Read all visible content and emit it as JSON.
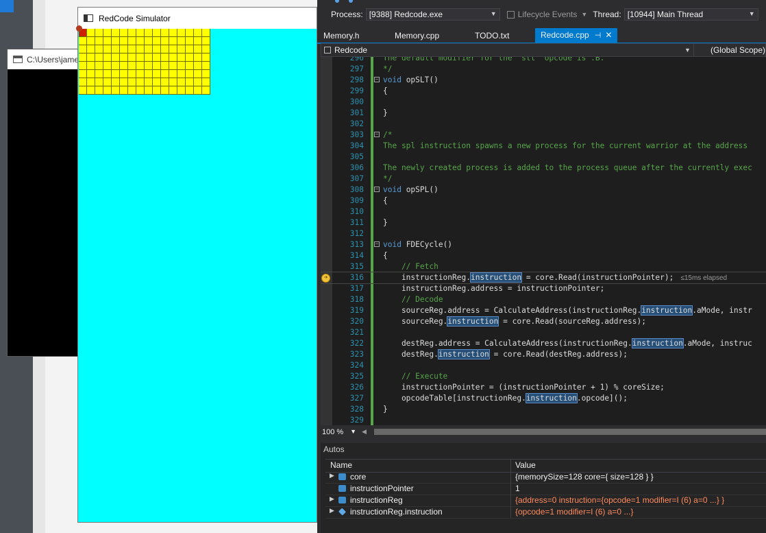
{
  "console": {
    "title": "C:\\Users\\jame"
  },
  "simulator": {
    "title": "RedCode Simulator",
    "memory": {
      "cells": 128,
      "columns": 16,
      "highlighted_cells": [
        0
      ]
    },
    "colors": {
      "background": "#00ffff",
      "cell": "#ffff00",
      "active_cell": "#cc2200"
    }
  },
  "debugbar": {
    "process_label": "Process:",
    "process_value": "[9388] Redcode.exe",
    "lifecycle_label": "Lifecycle Events",
    "thread_label": "Thread:",
    "thread_value": "[10944] Main Thread"
  },
  "tabs": [
    {
      "label": "Memory.h"
    },
    {
      "label": "Memory.cpp"
    },
    {
      "label": "TODO.txt"
    },
    {
      "label": "Redcode.cpp",
      "active": true
    }
  ],
  "navbar": {
    "project": "Redcode",
    "scope": "(Global Scope)"
  },
  "editor": {
    "lines": [
      {
        "n": "296",
        "text": "The default modifier for the 'slt' opcode is .B.",
        "type": "comment"
      },
      {
        "n": "297",
        "text": "*/",
        "type": "comment"
      },
      {
        "n": "298",
        "text": "void opSLT()",
        "type": "func",
        "fold": true
      },
      {
        "n": "299",
        "text": "{",
        "type": "plain"
      },
      {
        "n": "300",
        "text": "",
        "type": "plain"
      },
      {
        "n": "301",
        "text": "}",
        "type": "plain"
      },
      {
        "n": "302",
        "text": "",
        "type": "plain"
      },
      {
        "n": "303",
        "text": "/*",
        "type": "comment",
        "fold": true
      },
      {
        "n": "304",
        "text": "The spl instruction spawns a new process for the current warrior at the address",
        "type": "comment"
      },
      {
        "n": "305",
        "text": "",
        "type": "plain"
      },
      {
        "n": "306",
        "text": "The newly created process is added to the process queue after the currently exec",
        "type": "comment"
      },
      {
        "n": "307",
        "text": "*/",
        "type": "comment"
      },
      {
        "n": "308",
        "text": "void opSPL()",
        "type": "func",
        "fold": true
      },
      {
        "n": "309",
        "text": "{",
        "type": "plain"
      },
      {
        "n": "310",
        "text": "",
        "type": "plain"
      },
      {
        "n": "311",
        "text": "}",
        "type": "plain"
      },
      {
        "n": "312",
        "text": "",
        "type": "plain"
      },
      {
        "n": "313",
        "text": "void FDECycle()",
        "type": "func",
        "fold": true
      },
      {
        "n": "314",
        "text": "{",
        "type": "plain"
      },
      {
        "n": "315",
        "text": "    // Fetch",
        "type": "comment"
      },
      {
        "n": "316",
        "text": "    instructionReg.instruction = core.Read(instructionPointer);",
        "type": "code",
        "current": true,
        "perf": "≤15ms elapsed"
      },
      {
        "n": "317",
        "text": "    instructionReg.address = instructionPointer;",
        "type": "code"
      },
      {
        "n": "318",
        "text": "    // Decode",
        "type": "comment"
      },
      {
        "n": "319",
        "text": "    sourceReg.address = CalculateAddress(instructionReg.instruction.aMode, instr",
        "type": "code"
      },
      {
        "n": "320",
        "text": "    sourceReg.instruction = core.Read(sourceReg.address);",
        "type": "code"
      },
      {
        "n": "321",
        "text": "",
        "type": "plain"
      },
      {
        "n": "322",
        "text": "    destReg.address = CalculateAddress(instructionReg.instruction.aMode, instruc",
        "type": "code"
      },
      {
        "n": "323",
        "text": "    destReg.instruction = core.Read(destReg.address);",
        "type": "code"
      },
      {
        "n": "324",
        "text": "",
        "type": "plain"
      },
      {
        "n": "325",
        "text": "    // Execute",
        "type": "comment"
      },
      {
        "n": "326",
        "text": "    instructionPointer = (instructionPointer + 1) % coreSize;",
        "type": "code"
      },
      {
        "n": "327",
        "text": "    opcodeTable[instructionReg.instruction.opcode]();",
        "type": "code"
      },
      {
        "n": "328",
        "text": "}",
        "type": "plain"
      },
      {
        "n": "329",
        "text": "",
        "type": "plain"
      }
    ],
    "highlight_word": "instruction"
  },
  "status": {
    "zoom": "100 %"
  },
  "autos": {
    "title": "Autos",
    "col_name": "Name",
    "col_value": "Value",
    "rows": [
      {
        "name": "core",
        "value": "{memorySize=128 core={ size=128 } }",
        "expandable": true,
        "changed": false
      },
      {
        "name": "instructionPointer",
        "value": "1",
        "expandable": false,
        "changed": false
      },
      {
        "name": "instructionReg",
        "value": "{address=0 instruction={opcode=1 modifier=I (6) a=0 ...} }",
        "expandable": true,
        "changed": true
      },
      {
        "name": "instructionReg.instruction",
        "value": "{opcode=1 modifier=I (6) a=0 ...}",
        "expandable": true,
        "changed": true
      }
    ]
  }
}
